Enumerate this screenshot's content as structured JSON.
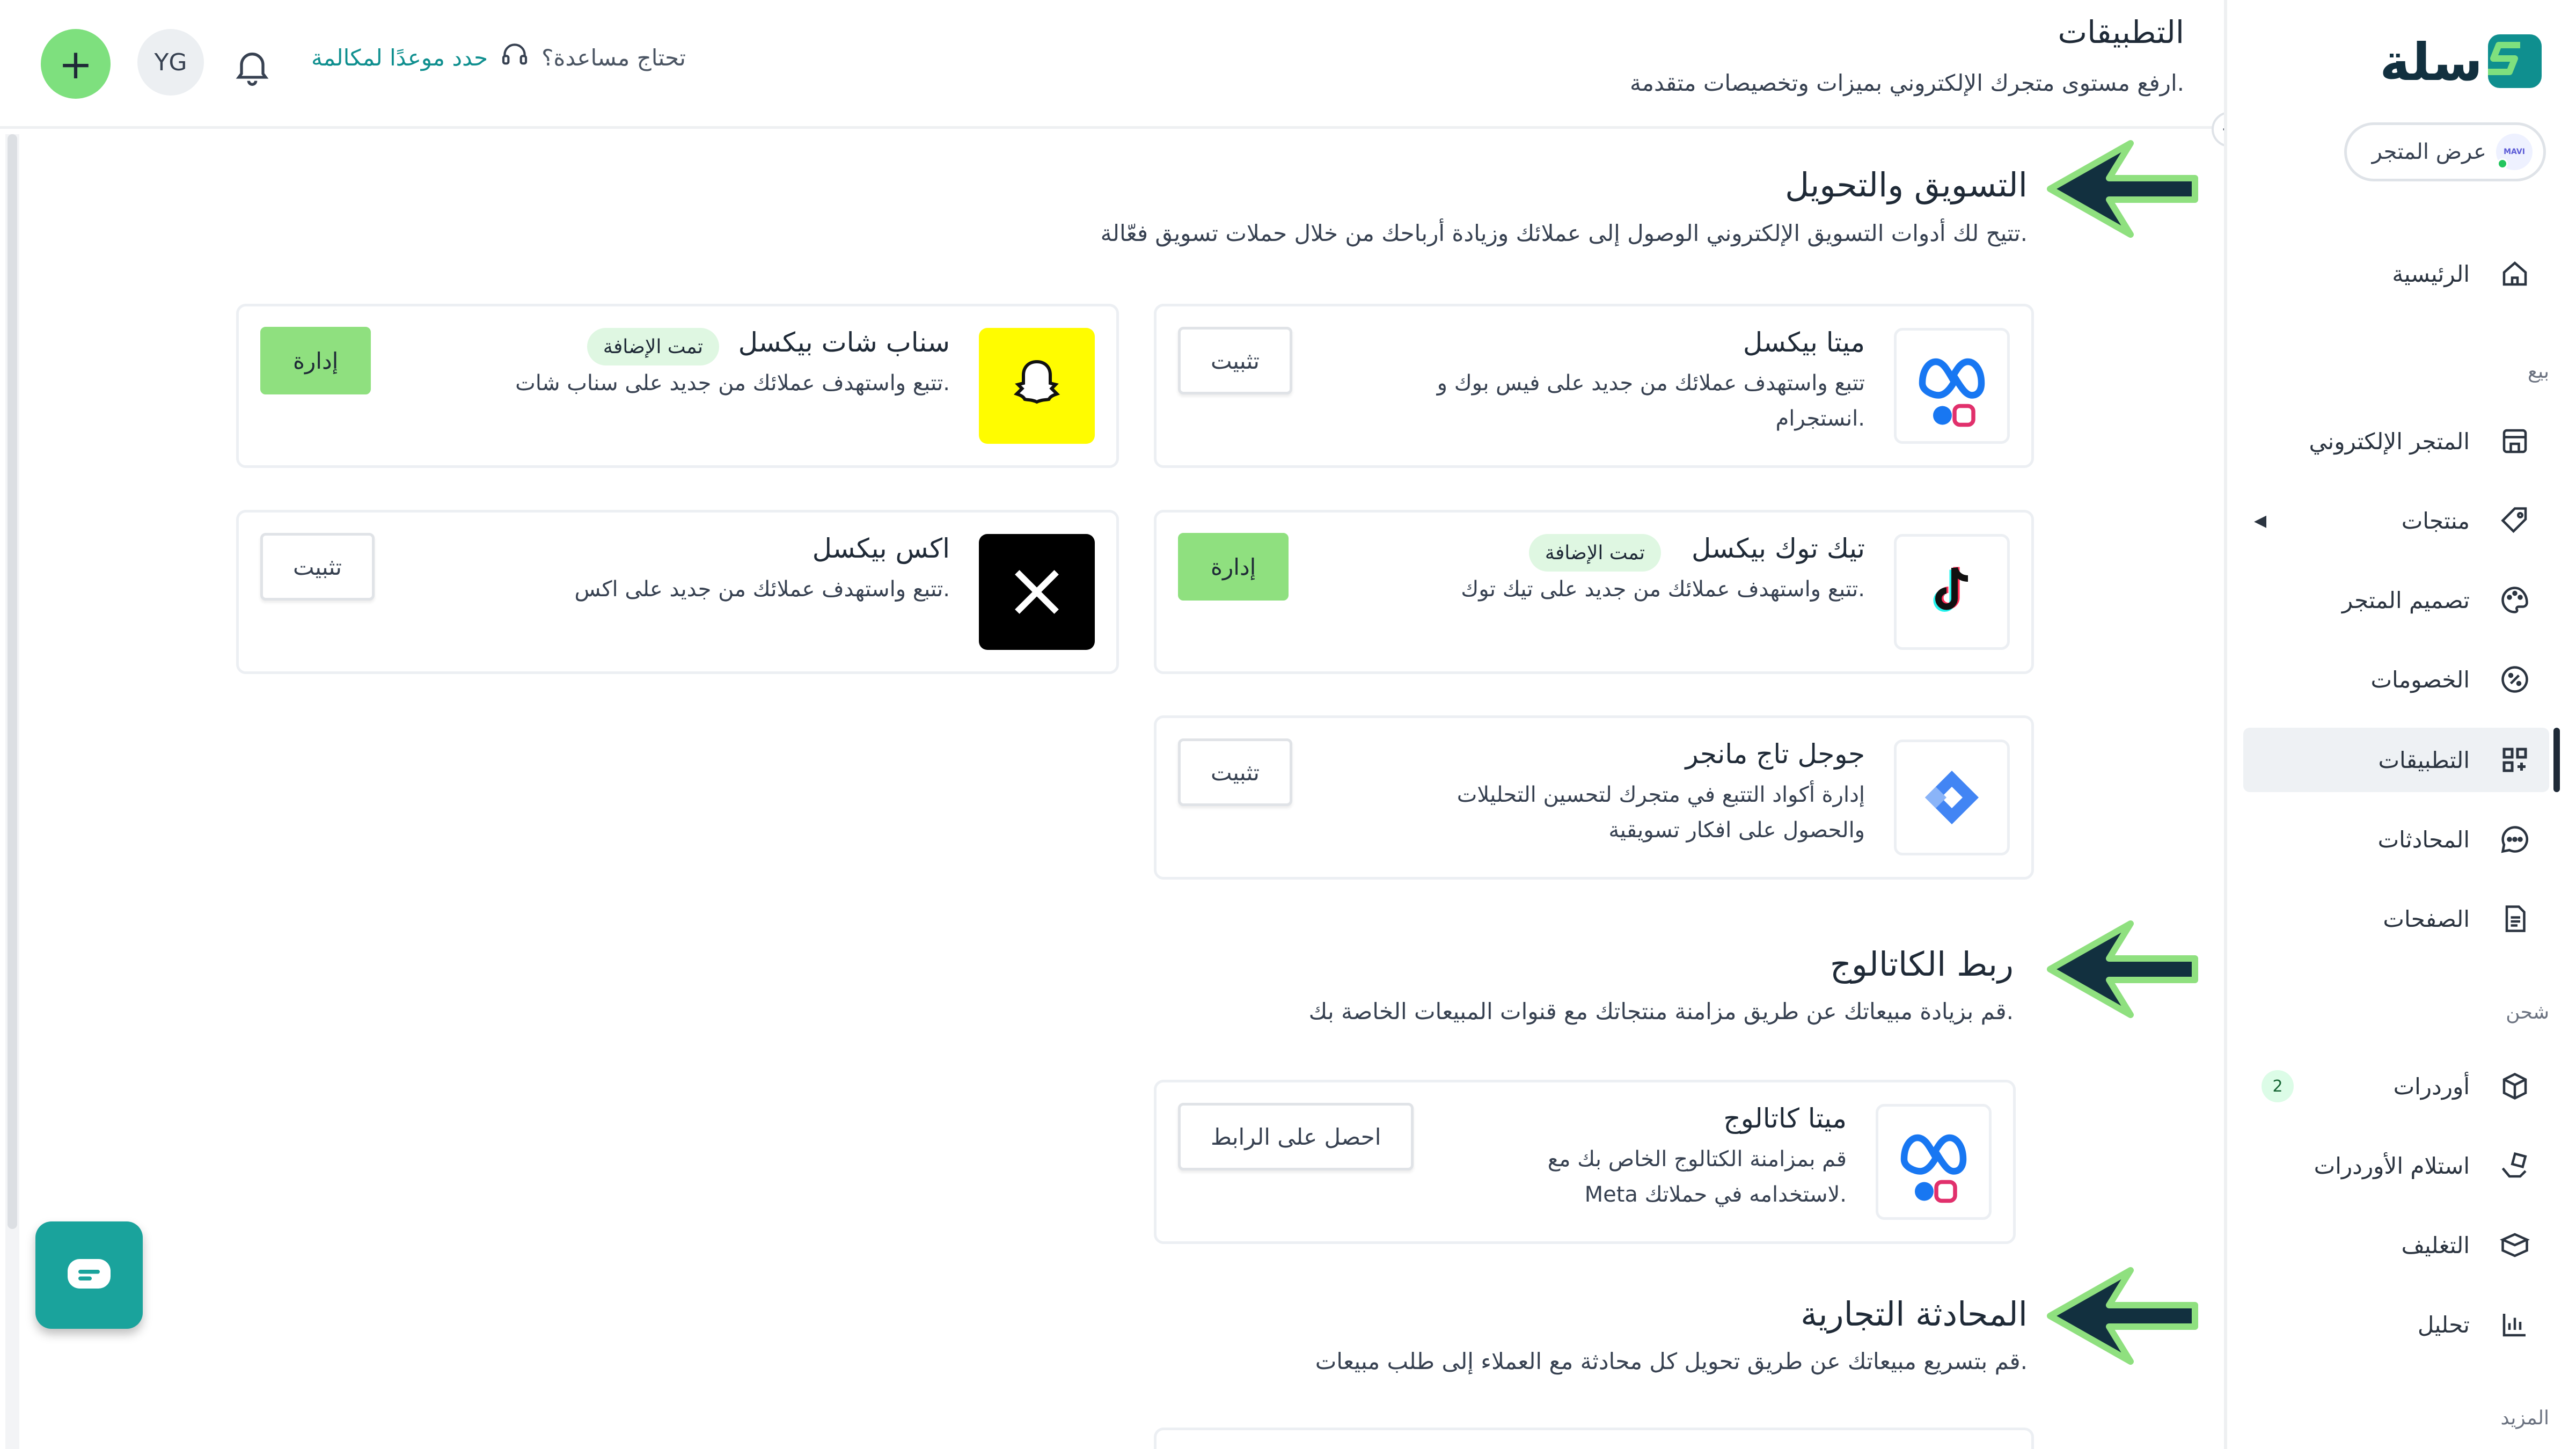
{
  "brand": {
    "logo_text": "سلة"
  },
  "header": {
    "title": "التطبيقات",
    "subtitle": "ارفع مستوى متجرك الإلكتروني بميزات وتخصيصات متقدمة.",
    "help_question": "تحتاج مساعدة؟",
    "help_link": "حدد موعدًا لمكالمة",
    "user_initials": "YG"
  },
  "store": {
    "view_label": "عرض المتجر",
    "avatar_text": "MAVI"
  },
  "sidebar": {
    "items": [
      {
        "label": "الرئيسية",
        "icon": "home-icon"
      },
      {
        "label": "المتجر الإلكتروني",
        "icon": "storefront-icon"
      },
      {
        "label": "منتجات",
        "icon": "tag-icon"
      },
      {
        "label": "تصميم المتجر",
        "icon": "palette-icon"
      },
      {
        "label": "الخصومات",
        "icon": "discount-icon"
      },
      {
        "label": "التطبيقات",
        "icon": "apps-grid-icon"
      },
      {
        "label": "المحادثات",
        "icon": "chat-icon"
      },
      {
        "label": "الصفحات",
        "icon": "document-icon"
      },
      {
        "label": "أوردرات",
        "icon": "package-icon",
        "badge": "2"
      },
      {
        "label": "استلام الأوردرات",
        "icon": "hand-box-icon"
      },
      {
        "label": "التغليف",
        "icon": "box-icon"
      },
      {
        "label": "تحليل",
        "icon": "chart-icon"
      }
    ],
    "sections": {
      "sell": "بيع",
      "shipping": "شحن",
      "more": "المزيد"
    }
  },
  "sections": {
    "marketing": {
      "title": "التسويق والتحويل",
      "desc": "تتيح لك أدوات التسويق الإلكتروني الوصول إلى عملائك وزيادة أرباحك من خلال حملات تسويق فعّالة."
    },
    "catalog": {
      "title": "ربط الكاتالوج",
      "desc": "قم بزيادة مبيعاتك عن طريق مزامنة منتجاتك مع قنوات المبيعات الخاصة بك."
    },
    "commerce_chat": {
      "title": "المحادثة التجارية",
      "desc": "قم بتسريع مبيعاتك عن طريق تحويل كل محادثة مع العملاء إلى طلب مبيعات."
    }
  },
  "apps": {
    "meta_pixel": {
      "name": "ميتا بيكسل",
      "desc_1": "تتبع واستهدف عملائك من جديد على فيس بوك و",
      "desc_2": "انستجرام.",
      "button": "تثبيت"
    },
    "snapchat_pixel": {
      "name": "سناب شات بيكسل",
      "badge": "تمت الإضافة",
      "desc_1": "تتبع واستهدف عملائك من جديد على سناب شات.",
      "button": "إدارة"
    },
    "tiktok_pixel": {
      "name": "تيك توك بيكسل",
      "badge": "تمت الإضافة",
      "desc_1": "تتبع واستهدف عملائك من جديد على تيك توك.",
      "button": "إدارة"
    },
    "x_pixel": {
      "name": "اكس بيكسل",
      "desc_1": "تتبع واستهدف عملائك من جديد على اكس.",
      "button": "تثبيت"
    },
    "gtm": {
      "name": "جوجل تاج مانجر",
      "desc_1": "إدارة أكواد التتبع في متجرك لتحسين التحليلات",
      "desc_2": "والحصول على افكار تسويقية",
      "button": "تثبيت"
    },
    "meta_catalog": {
      "name": "ميتا كاتالوج",
      "desc_1": "قم بمزامنة الكتالوج الخاص بك مع",
      "desc_2": "Meta لاستخدامه في حملاتك.",
      "button": "احصل على الرابط"
    }
  },
  "colors": {
    "accent_green": "#8fe07f",
    "teal": "#1aa39c",
    "brand_teal": "#0f8f8f",
    "arrow_fill": "#12303f",
    "arrow_outline": "#8fe07f"
  }
}
